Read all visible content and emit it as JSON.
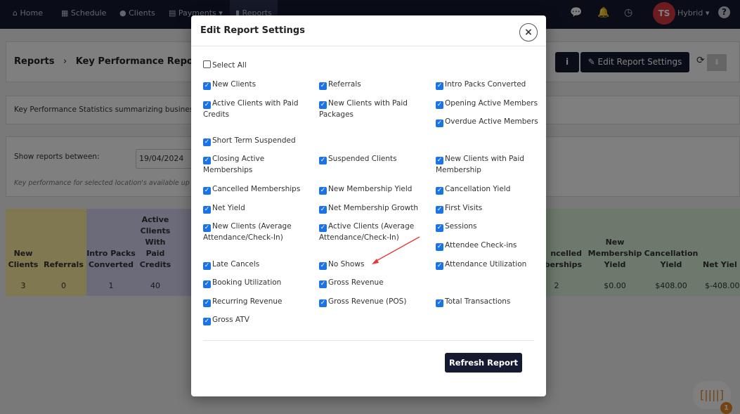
{
  "nav": {
    "items": [
      "Home",
      "Schedule",
      "Clients",
      "Payments ▾",
      "Reports"
    ],
    "active": "Reports",
    "user_initials": "TS",
    "user_name": "Hybrid ▾",
    "icons": [
      "chat-icon",
      "bell-icon",
      "clock-icon",
      "help-icon"
    ]
  },
  "page": {
    "breadcrumb": [
      "Reports",
      "Key Performance Report"
    ],
    "separator": "›",
    "info_label": "i",
    "edit_settings_label": "Edit Report Settings",
    "description": "Key Performance Statistics summarizing business pe",
    "date_label": "Show reports between:",
    "date_from": "19/04/2024",
    "note": "Key performance for selected location's available up to"
  },
  "table": {
    "headers": [
      "New Clients",
      "Referrals",
      "Intro Packs Converted",
      "Active Clients With Paid Credits",
      "ncelled mberships",
      "New Membership Yield",
      "Cancellation Yield",
      "Net Yiel"
    ],
    "values": [
      "3",
      "0",
      "1",
      "40",
      "2",
      "$0.00",
      "$408.00",
      "$-408.00"
    ],
    "colors": {
      "yellow": "#fff1a0",
      "purple": "#d6d6f2",
      "green": "#d9f2d9"
    }
  },
  "modal": {
    "title": "Edit Report Settings",
    "close": "×",
    "select_all": {
      "label": "Select All",
      "checked": false
    },
    "options": [
      {
        "label": "New Clients",
        "checked": true
      },
      {
        "label": "Referrals",
        "checked": true
      },
      {
        "label": "Intro Packs Converted",
        "checked": true
      },
      {
        "label": "Active Clients with Paid Credits",
        "checked": true
      },
      {
        "label": "New Clients with Paid Packages",
        "checked": true
      },
      {
        "label": "Opening Active Members",
        "checked": true
      },
      {
        "label": "Overdue Active Members",
        "checked": true
      },
      {
        "label": "Short Term Suspended",
        "checked": true
      },
      {
        "label": "Closing Active Memberships",
        "checked": true
      },
      {
        "label": "Suspended Clients",
        "checked": true
      },
      {
        "label": "New Clients with Paid Membership",
        "checked": true
      },
      {
        "label": "Cancelled Memberships",
        "checked": true
      },
      {
        "label": "New Membership Yield",
        "checked": true
      },
      {
        "label": "Cancellation Yield",
        "checked": true
      },
      {
        "label": "Net Yield",
        "checked": true
      },
      {
        "label": "Net Membership Growth",
        "checked": true
      },
      {
        "label": "First Visits",
        "checked": true
      },
      {
        "label": "New Clients (Average Attendance/Check-In)",
        "checked": true
      },
      {
        "label": "Active Clients (Average Attendance/Check-In)",
        "checked": true
      },
      {
        "label": "Sessions",
        "checked": true
      },
      {
        "label": "Attendee Check-ins",
        "checked": true
      },
      {
        "label": "Late Cancels",
        "checked": true
      },
      {
        "label": "No Shows",
        "checked": true
      },
      {
        "label": "Attendance Utilization",
        "checked": true
      },
      {
        "label": "Booking Utilization",
        "checked": true
      },
      {
        "label": "Gross Revenue",
        "checked": true
      },
      {
        "label": "Recurring Revenue",
        "checked": true
      },
      {
        "label": "Gross Revenue (POS)",
        "checked": true
      },
      {
        "label": "Total Transactions",
        "checked": true
      },
      {
        "label": "Gross ATV",
        "checked": true
      }
    ],
    "refresh_label": "Refresh Report",
    "annotation_color": "#e53935"
  },
  "widget": {
    "badge_count": "1",
    "icon": "barcode-icon",
    "accent": "#e8871e"
  }
}
